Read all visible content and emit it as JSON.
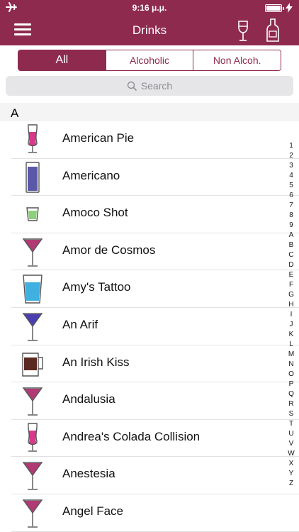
{
  "colors": {
    "accent": "#8e2a4d"
  },
  "status_bar": {
    "time": "9:16 μ.μ.",
    "airplane_icon": "airplane-icon",
    "battery_level": 1.0
  },
  "nav": {
    "title": "Drinks",
    "menu_icon": "hamburger-menu-icon",
    "glass_icon": "wine-glass-icon",
    "bottle_icon": "bottle-icon"
  },
  "filter": {
    "tabs": [
      "All",
      "Alcoholic",
      "Non Alcoh."
    ],
    "selected": "All"
  },
  "search": {
    "placeholder": "Search"
  },
  "section": {
    "letter": "A"
  },
  "drinks": [
    {
      "name": "American Pie",
      "glass": "hurricane",
      "color": "#d63a8a"
    },
    {
      "name": "Americano",
      "glass": "highball",
      "color": "#5a58a8"
    },
    {
      "name": "Amoco Shot",
      "glass": "shot",
      "color": "#8dd07a"
    },
    {
      "name": "Amor de Cosmos",
      "glass": "martini",
      "color": "#b13a74"
    },
    {
      "name": "Amy's Tattoo",
      "glass": "tumbler",
      "color": "#3fb0e0"
    },
    {
      "name": "An Arif",
      "glass": "martini",
      "color": "#4a3fb0"
    },
    {
      "name": "An Irish Kiss",
      "glass": "mug",
      "color": "#5a2a22"
    },
    {
      "name": "Andalusia",
      "glass": "martini",
      "color": "#b13a74"
    },
    {
      "name": "Andrea's Colada Collision",
      "glass": "hurricane",
      "color": "#d63a8a"
    },
    {
      "name": "Anestesia",
      "glass": "martini",
      "color": "#b13a74"
    },
    {
      "name": "Angel Face",
      "glass": "martini",
      "color": "#b13a74"
    }
  ],
  "index": [
    "1",
    "2",
    "3",
    "4",
    "5",
    "6",
    "7",
    "8",
    "9",
    "A",
    "B",
    "C",
    "D",
    "E",
    "F",
    "G",
    "H",
    "I",
    "J",
    "K",
    "L",
    "M",
    "N",
    "O",
    "P",
    "Q",
    "R",
    "S",
    "T",
    "U",
    "V",
    "W",
    "X",
    "Y",
    "Z"
  ]
}
